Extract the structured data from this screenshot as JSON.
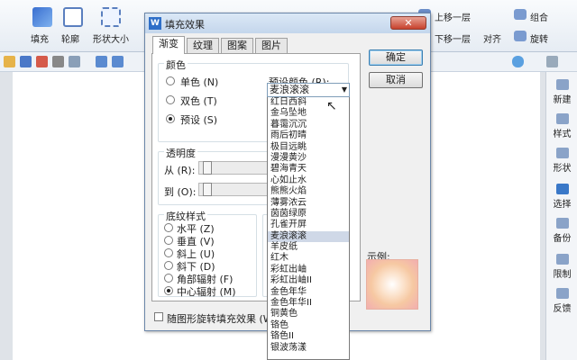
{
  "toolbar": {
    "fill_label": "填充",
    "outline_label": "轮廓",
    "shape_size_label": "形状大小",
    "up_layer_label": "上移一层",
    "down_layer_label": "下移一层",
    "group_label": "组合",
    "rotate_label": "旋转",
    "align_label": "对齐"
  },
  "dialog": {
    "title": "填充效果",
    "tabs": [
      "渐变",
      "纹理",
      "图案",
      "图片"
    ],
    "color_group": "颜色",
    "color_options": [
      "单色 (N)",
      "双色 (T)",
      "预设 (S)"
    ],
    "preset_label": "预设颜色 (R):",
    "preset_selected": "麦浪滚滚",
    "transparency_group": "透明度",
    "from_label": "从 (R):",
    "to_label": "到 (O):",
    "shading_group": "底纹样式",
    "shading_options": [
      "水平 (Z)",
      "垂直 (V)",
      "斜上 (U)",
      "斜下 (D)",
      "角部辐射 (F)",
      "中心辐射 (M)"
    ],
    "ok_label": "确定",
    "cancel_label": "取消",
    "sample_label": "示例:",
    "rotate_fill_label": "随图形旋转填充效果 (W)"
  },
  "preset_options": [
    "红日西斜",
    "金乌坠地",
    "暮霭沉沉",
    "雨后初晴",
    "极目远眺",
    "漫漫黄沙",
    "碧海青天",
    "心如止水",
    "熊熊火焰",
    "薄雾浓云",
    "茵茵绿原",
    "孔雀开屏",
    "麦浪滚滚",
    "羊皮纸",
    "红木",
    "彩虹出岫",
    "彩虹出岫II",
    "金色年华",
    "金色年华II",
    "铜黄色",
    "铬色",
    "铬色II",
    "银波荡漾"
  ],
  "right_panel": [
    "新建",
    "样式",
    "形状",
    "选择",
    "备份",
    "限制",
    "反馈"
  ],
  "colors": {
    "accent": "#3c7fb1",
    "selected": "#cfd8e7"
  }
}
